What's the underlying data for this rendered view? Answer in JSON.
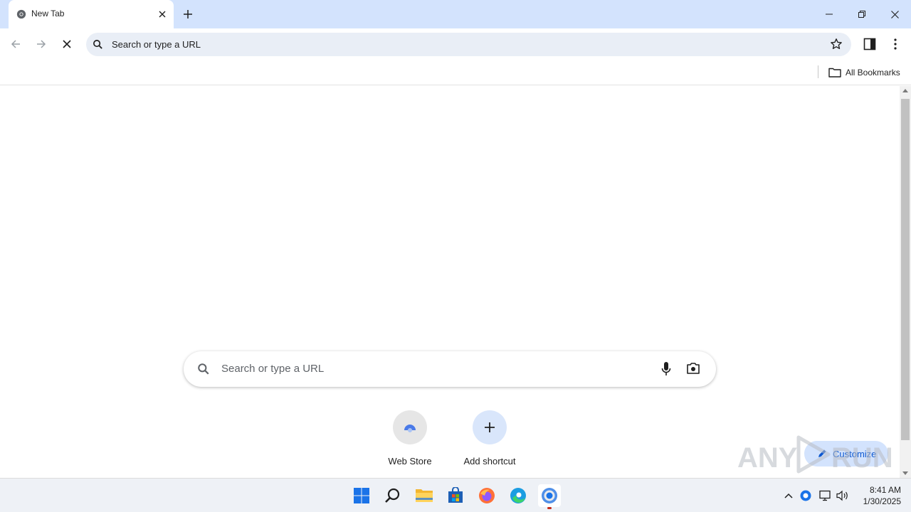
{
  "browser": {
    "tab": {
      "title": "New Tab"
    },
    "omnibox": {
      "placeholder": "Search or type a URL"
    },
    "bookmarks_bar": {
      "all_bookmarks_label": "All Bookmarks"
    }
  },
  "ntp": {
    "search_placeholder": "Search or type a URL",
    "shortcuts": [
      {
        "label": "Web Store",
        "icon": "web-store-icon"
      },
      {
        "label": "Add shortcut",
        "icon": "plus-icon"
      }
    ],
    "customize_label": "Customize"
  },
  "watermark": {
    "text": "ANY RUN"
  },
  "taskbar": {
    "apps": [
      "windows-start",
      "search",
      "file-explorer",
      "microsoft-store",
      "firefox",
      "edge",
      "chrome"
    ],
    "clock": {
      "time": "8:41 AM",
      "date": "1/30/2025"
    }
  },
  "colors": {
    "tabstrip": "#d3e3fd",
    "omnibox": "#e9eef6",
    "accent": "#0b57d0",
    "taskbar": "#eef1f6"
  }
}
